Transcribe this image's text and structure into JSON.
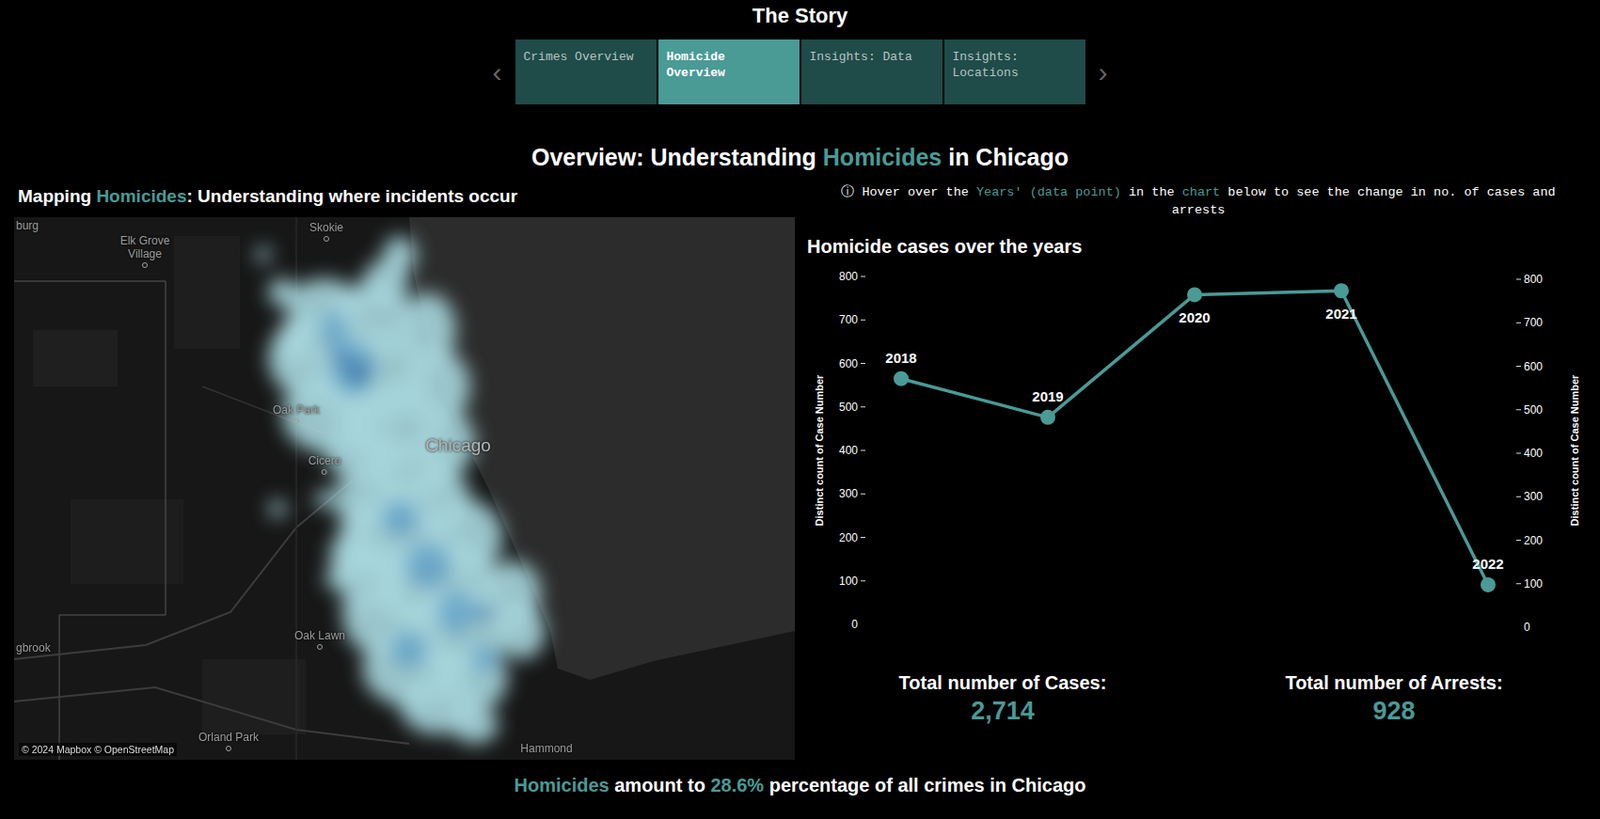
{
  "story": {
    "title": "The Story",
    "prev": "‹",
    "next": "›"
  },
  "tabs": [
    {
      "label": "Crimes Overview",
      "selected": false
    },
    {
      "label": "Homicide Overview",
      "selected": true
    },
    {
      "label": "Insights: Data",
      "selected": false
    },
    {
      "label": "Insights: Locations",
      "selected": false
    }
  ],
  "title": [
    {
      "text": "Overview: Understanding ",
      "accent": false
    },
    {
      "text": "Homicides",
      "accent": true
    },
    {
      "text": " in Chicago",
      "accent": false
    }
  ],
  "map": {
    "title": [
      {
        "text": "Mapping ",
        "accent": false
      },
      {
        "text": "Homicides",
        "accent": true
      },
      {
        "text": ": Understanding where incidents occur",
        "accent": false
      }
    ],
    "labels": [
      {
        "text": "burg",
        "dot": false
      },
      {
        "text": "Elk Grove Village",
        "dot": true
      },
      {
        "text": "Skokie",
        "dot": true
      },
      {
        "text": "Oak Park",
        "dot": true
      },
      {
        "text": "Chicago",
        "dot": false
      },
      {
        "text": "Cicero",
        "dot": true
      },
      {
        "text": "Oak Lawn",
        "dot": true
      },
      {
        "text": "gbrook",
        "dot": false
      },
      {
        "text": "Orland Park",
        "dot": true
      },
      {
        "text": "Hammond",
        "dot": false
      }
    ],
    "attribution": "© 2024 Mapbox © OpenStreetMap"
  },
  "hint": [
    {
      "text": "ⓘ Hover over the ",
      "accent": false
    },
    {
      "text": "Years' (data point)",
      "accent": true
    },
    {
      "text": " in the ",
      "accent": false
    },
    {
      "text": "chart",
      "accent": true
    },
    {
      "text": " below to see the change in no. of cases and arrests",
      "accent": false
    }
  ],
  "chart": {
    "title": "Homicide cases over the years",
    "y_axis_title": "Distinct count of Case Number",
    "y_ticks": [
      "800",
      "700",
      "600",
      "500",
      "400",
      "300",
      "200",
      "100",
      "0"
    ],
    "series": [
      {
        "name": "Homicide cases",
        "labels": [
          "2018",
          "2019",
          "2020",
          "2021",
          "2022"
        ],
        "values": [
          565,
          476,
          758,
          767,
          91
        ]
      }
    ]
  },
  "kpis": [
    {
      "label": "Total number of Cases:",
      "value": "2,714"
    },
    {
      "label": "Total number of Arrests:",
      "value": "928"
    }
  ],
  "footer": [
    {
      "text": "Homicides",
      "accent": true
    },
    {
      "text": " amount to ",
      "accent": false
    },
    {
      "text": "28.6%",
      "accent": true
    },
    {
      "text": " percentage of all crimes in Chicago",
      "accent": false
    }
  ]
}
